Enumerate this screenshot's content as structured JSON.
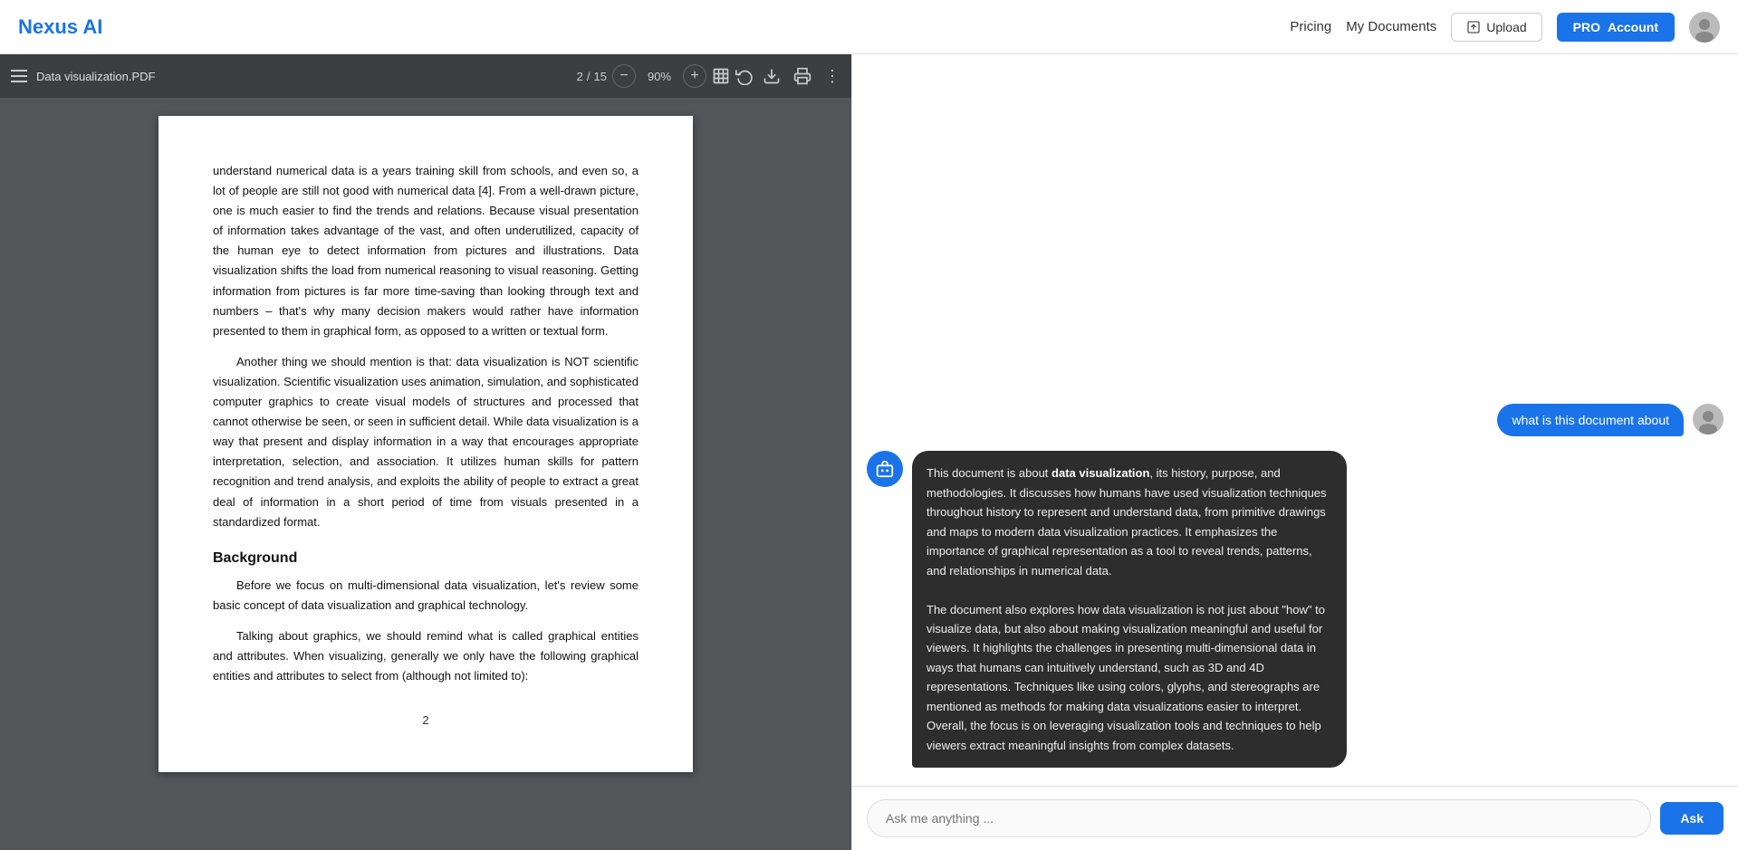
{
  "navbar": {
    "logo_text": "Nexus ",
    "logo_accent": "AI",
    "pricing_label": "Pricing",
    "my_documents_label": "My Documents",
    "upload_label": "Upload",
    "pro_label": "PRO",
    "account_label": "Account"
  },
  "pdf": {
    "filename": "Data visualization.PDF",
    "current_page": "2",
    "total_pages": "15",
    "zoom": "90%",
    "content_paragraphs": [
      "understand numerical data is a years training skill from schools, and even so, a lot of people are still not good with numerical data [4]. From a well-drawn picture, one is much easier to find the trends and relations. Because visual presentation of information takes advantage of the vast, and often underutilized, capacity of the human eye to detect information from pictures and illustrations. Data visualization shifts the load from numerical reasoning to visual reasoning. Getting information from pictures is far more time-saving than looking through text and numbers – that's why many decision makers would rather have information presented to them in graphical form, as opposed to a written or textual form.",
      "Another thing we should mention is that: data visualization is NOT scientific visualization. Scientific visualization uses animation, simulation, and sophisticated computer graphics to create visual models of structures and processed that cannot otherwise be seen, or seen in sufficient detail. While data visualization is a way that present and display information in a way that encourages appropriate interpretation, selection, and association. It utilizes human skills for pattern recognition and trend analysis, and exploits the ability of people to extract a great deal of information in a short period of time from visuals presented in a standardized format.",
      "Background",
      "Before we focus on multi-dimensional data visualization, let's review some basic concept of data visualization and graphical technology.",
      "Talking about graphics, we should remind what is called graphical entities and attributes. When visualizing, generally we only have the following graphical entities and attributes to select from (although not limited to):"
    ],
    "page_number": "2"
  },
  "chat": {
    "user_message": "what is this document about",
    "bot_response_1": "This document is about ",
    "bot_response_bold": "data visualization",
    "bot_response_2": ", its history, purpose, and methodologies. It discusses how humans have used visualization techniques throughout history to represent and understand data, from primitive drawings and maps to modern data visualization practices. It emphasizes the importance of graphical representation as a tool to reveal trends, patterns, and relationships in numerical data.",
    "bot_response_3": "The document also explores how data visualization is not just about \"how\" to visualize data, but also about making visualization meaningful and useful for viewers. It highlights the challenges in presenting multi-dimensional data in ways that humans can intuitively understand, such as 3D and 4D representations. Techniques like using colors, glyphs, and stereographs are mentioned as methods for making data visualizations easier to interpret. Overall, the focus is on leveraging visualization tools and techniques to help viewers extract meaningful insights from complex datasets.",
    "input_placeholder": "Ask me anything ...",
    "ask_button_label": "Ask"
  }
}
